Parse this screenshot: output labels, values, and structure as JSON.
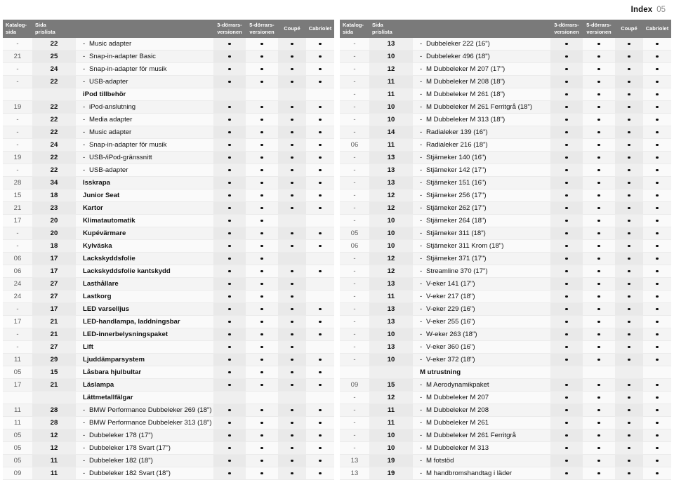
{
  "header": {
    "index_label": "Index",
    "index_number": "05"
  },
  "columns": {
    "katalog_line1": "Katalog-",
    "katalog_line2": "sida",
    "sida_line1": "Sida",
    "sida_line2": "prislista",
    "name": "",
    "d1_line1": "3-dörrars-",
    "d1_line2": "versionen",
    "d2_line1": "5-dörrars-",
    "d2_line2": "versionen",
    "d3": "Coupé",
    "d4": "Cabriolet"
  },
  "left_rows": [
    {
      "kat": "-",
      "sida": "22",
      "dash": "-",
      "name": "Music adapter",
      "bold": false,
      "dots": [
        1,
        1,
        1,
        1
      ]
    },
    {
      "kat": "21",
      "sida": "25",
      "dash": "-",
      "name": "Snap-in-adapter Basic",
      "bold": false,
      "dots": [
        1,
        1,
        1,
        1
      ]
    },
    {
      "kat": "-",
      "sida": "24",
      "dash": "-",
      "name": "Snap-in-adapter för musik",
      "bold": false,
      "dots": [
        1,
        1,
        1,
        1
      ]
    },
    {
      "kat": "-",
      "sida": "22",
      "dash": "-",
      "name": "USB-adapter",
      "bold": false,
      "dots": [
        1,
        1,
        1,
        1
      ]
    },
    {
      "kat": "",
      "sida": "",
      "dash": "",
      "name": "iPod tillbehör",
      "bold": true,
      "group": true,
      "dots": [
        0,
        0,
        0,
        0
      ]
    },
    {
      "kat": "19",
      "sida": "22",
      "dash": "-",
      "name": "iPod-anslutning",
      "bold": false,
      "dots": [
        1,
        1,
        1,
        1
      ]
    },
    {
      "kat": "-",
      "sida": "22",
      "dash": "-",
      "name": "Media adapter",
      "bold": false,
      "dots": [
        1,
        1,
        1,
        1
      ]
    },
    {
      "kat": "-",
      "sida": "22",
      "dash": "-",
      "name": "Music adapter",
      "bold": false,
      "dots": [
        1,
        1,
        1,
        1
      ]
    },
    {
      "kat": "-",
      "sida": "24",
      "dash": "-",
      "name": "Snap-in-adapter för musik",
      "bold": false,
      "dots": [
        1,
        1,
        1,
        1
      ]
    },
    {
      "kat": "19",
      "sida": "22",
      "dash": "-",
      "name": "USB-/iPod-gränssnitt",
      "bold": false,
      "dots": [
        1,
        1,
        1,
        1
      ]
    },
    {
      "kat": "-",
      "sida": "22",
      "dash": "-",
      "name": "USB-adapter",
      "bold": false,
      "dots": [
        1,
        1,
        1,
        1
      ]
    },
    {
      "kat": "28",
      "sida": "34",
      "dash": "",
      "name": "Isskrapa",
      "bold": true,
      "dots": [
        1,
        1,
        1,
        1
      ]
    },
    {
      "kat": "15",
      "sida": "18",
      "dash": "",
      "name": "Junior Seat",
      "bold": true,
      "dots": [
        1,
        1,
        1,
        1
      ]
    },
    {
      "kat": "21",
      "sida": "23",
      "dash": "",
      "name": "Kartor",
      "bold": true,
      "dots": [
        1,
        1,
        1,
        1
      ]
    },
    {
      "kat": "17",
      "sida": "20",
      "dash": "",
      "name": "Klimatautomatik",
      "bold": true,
      "dots": [
        1,
        1,
        0,
        0
      ]
    },
    {
      "kat": "-",
      "sida": "20",
      "dash": "",
      "name": "Kupévärmare",
      "bold": true,
      "dots": [
        1,
        1,
        1,
        1
      ]
    },
    {
      "kat": "-",
      "sida": "18",
      "dash": "",
      "name": "Kylväska",
      "bold": true,
      "dots": [
        1,
        1,
        1,
        1
      ]
    },
    {
      "kat": "06",
      "sida": "17",
      "dash": "",
      "name": "Lackskyddsfolie",
      "bold": true,
      "dots": [
        1,
        1,
        0,
        0
      ]
    },
    {
      "kat": "06",
      "sida": "17",
      "dash": "",
      "name": "Lackskyddsfolie kantskydd",
      "bold": true,
      "dots": [
        1,
        1,
        1,
        1
      ]
    },
    {
      "kat": "24",
      "sida": "27",
      "dash": "",
      "name": "Lasthållare",
      "bold": true,
      "dots": [
        1,
        1,
        1,
        0
      ]
    },
    {
      "kat": "24",
      "sida": "27",
      "dash": "",
      "name": "Lastkorg",
      "bold": true,
      "dots": [
        1,
        1,
        1,
        0
      ]
    },
    {
      "kat": "-",
      "sida": "17",
      "dash": "",
      "name": "LED varselljus",
      "bold": true,
      "dots": [
        1,
        1,
        1,
        1
      ]
    },
    {
      "kat": "17",
      "sida": "21",
      "dash": "",
      "name": "LED-handlampa, laddningsbar",
      "bold": true,
      "dots": [
        1,
        1,
        1,
        1
      ]
    },
    {
      "kat": "-",
      "sida": "21",
      "dash": "",
      "name": "LED-innerbelysningspaket",
      "bold": true,
      "dots": [
        1,
        1,
        1,
        1
      ]
    },
    {
      "kat": "-",
      "sida": "27",
      "dash": "",
      "name": "Lift",
      "bold": true,
      "dots": [
        1,
        1,
        1,
        0
      ]
    },
    {
      "kat": "11",
      "sida": "29",
      "dash": "",
      "name": "Ljuddämparsystem",
      "bold": true,
      "dots": [
        1,
        1,
        1,
        1
      ]
    },
    {
      "kat": "05",
      "sida": "15",
      "dash": "",
      "name": "Låsbara hjulbultar",
      "bold": true,
      "dots": [
        1,
        1,
        1,
        1
      ]
    },
    {
      "kat": "17",
      "sida": "21",
      "dash": "",
      "name": "Läslampa",
      "bold": true,
      "dots": [
        1,
        1,
        1,
        1
      ]
    },
    {
      "kat": "",
      "sida": "",
      "dash": "",
      "name": "Lättmetallfälgar",
      "bold": true,
      "group": true,
      "dots": [
        0,
        0,
        0,
        0
      ]
    },
    {
      "kat": "11",
      "sida": "28",
      "dash": "-",
      "name": "BMW Performance Dubbeleker 269 (18\")",
      "bold": false,
      "dots": [
        1,
        1,
        1,
        1
      ]
    },
    {
      "kat": "11",
      "sida": "28",
      "dash": "-",
      "name": "BMW Performance Dubbeleker 313 (18\")",
      "bold": false,
      "dots": [
        1,
        1,
        1,
        1
      ]
    },
    {
      "kat": "05",
      "sida": "12",
      "dash": "-",
      "name": "Dubbeleker 178 (17\")",
      "bold": false,
      "dots": [
        1,
        1,
        1,
        1
      ]
    },
    {
      "kat": "05",
      "sida": "12",
      "dash": "-",
      "name": "Dubbeleker 178 Svart (17\")",
      "bold": false,
      "dots": [
        1,
        1,
        1,
        1
      ]
    },
    {
      "kat": "05",
      "sida": "11",
      "dash": "-",
      "name": "Dubbeleker 182 (18\")",
      "bold": false,
      "dots": [
        1,
        1,
        1,
        1
      ]
    },
    {
      "kat": "09",
      "sida": "11",
      "dash": "-",
      "name": "Dubbeleker 182 Svart (18\")",
      "bold": false,
      "dots": [
        1,
        1,
        1,
        1
      ]
    }
  ],
  "right_rows": [
    {
      "kat": "-",
      "sida": "13",
      "dash": "-",
      "name": "Dubbeleker 222 (16\")",
      "bold": false,
      "dots": [
        1,
        1,
        1,
        1
      ]
    },
    {
      "kat": "-",
      "sida": "10",
      "dash": "-",
      "name": "Dubbeleker 496 (18\")",
      "bold": false,
      "dots": [
        1,
        1,
        1,
        1
      ]
    },
    {
      "kat": "-",
      "sida": "12",
      "dash": "-",
      "name": "M Dubbeleker M 207 (17\")",
      "bold": false,
      "dots": [
        1,
        1,
        1,
        1
      ]
    },
    {
      "kat": "-",
      "sida": "11",
      "dash": "-",
      "name": "M Dubbeleker M 208 (18\")",
      "bold": false,
      "dots": [
        1,
        1,
        1,
        1
      ]
    },
    {
      "kat": "-",
      "sida": "11",
      "dash": "-",
      "name": "M Dubbeleker M 261 (18\")",
      "bold": false,
      "dots": [
        1,
        1,
        1,
        1
      ]
    },
    {
      "kat": "-",
      "sida": "10",
      "dash": "-",
      "name": "M Dubbeleker M 261 Ferritgrå (18\")",
      "bold": false,
      "dots": [
        1,
        1,
        1,
        1
      ]
    },
    {
      "kat": "-",
      "sida": "10",
      "dash": "-",
      "name": "M Dubbeleker M 313 (18\")",
      "bold": false,
      "dots": [
        1,
        1,
        1,
        1
      ]
    },
    {
      "kat": "-",
      "sida": "14",
      "dash": "-",
      "name": "Radialeker 139 (16\")",
      "bold": false,
      "dots": [
        1,
        1,
        1,
        1
      ]
    },
    {
      "kat": "06",
      "sida": "11",
      "dash": "-",
      "name": "Radialeker 216 (18\")",
      "bold": false,
      "dots": [
        1,
        1,
        1,
        1
      ]
    },
    {
      "kat": "-",
      "sida": "13",
      "dash": "-",
      "name": "Stjärneker 140 (16\")",
      "bold": false,
      "dots": [
        1,
        1,
        1,
        1
      ]
    },
    {
      "kat": "-",
      "sida": "13",
      "dash": "-",
      "name": "Stjärneker 142 (17\")",
      "bold": false,
      "dots": [
        1,
        1,
        1,
        1
      ]
    },
    {
      "kat": "-",
      "sida": "13",
      "dash": "-",
      "name": "Stjärneker 151 (16\")",
      "bold": false,
      "dots": [
        1,
        1,
        1,
        1
      ]
    },
    {
      "kat": "-",
      "sida": "12",
      "dash": "-",
      "name": "Stjärneker 256 (17\")",
      "bold": false,
      "dots": [
        1,
        1,
        1,
        1
      ]
    },
    {
      "kat": "-",
      "sida": "12",
      "dash": "-",
      "name": "Stjärneker 262 (17\")",
      "bold": false,
      "dots": [
        1,
        1,
        1,
        1
      ]
    },
    {
      "kat": "-",
      "sida": "10",
      "dash": "-",
      "name": "Stjärneker 264 (18\")",
      "bold": false,
      "dots": [
        1,
        1,
        1,
        1
      ]
    },
    {
      "kat": "05",
      "sida": "10",
      "dash": "-",
      "name": "Stjärneker 311 (18\")",
      "bold": false,
      "dots": [
        1,
        1,
        1,
        1
      ]
    },
    {
      "kat": "06",
      "sida": "10",
      "dash": "-",
      "name": "Stjärneker 311 Krom (18\")",
      "bold": false,
      "dots": [
        1,
        1,
        1,
        1
      ]
    },
    {
      "kat": "-",
      "sida": "12",
      "dash": "-",
      "name": "Stjärneker 371 (17\")",
      "bold": false,
      "dots": [
        1,
        1,
        1,
        1
      ]
    },
    {
      "kat": "-",
      "sida": "12",
      "dash": "-",
      "name": "Streamline 370 (17\")",
      "bold": false,
      "dots": [
        1,
        1,
        1,
        1
      ]
    },
    {
      "kat": "-",
      "sida": "13",
      "dash": "-",
      "name": "V-eker 141 (17\")",
      "bold": false,
      "dots": [
        1,
        1,
        1,
        1
      ]
    },
    {
      "kat": "-",
      "sida": "11",
      "dash": "-",
      "name": "V-eker 217 (18\")",
      "bold": false,
      "dots": [
        1,
        1,
        1,
        1
      ]
    },
    {
      "kat": "-",
      "sida": "13",
      "dash": "-",
      "name": "V-eker 229 (16\")",
      "bold": false,
      "dots": [
        1,
        1,
        1,
        1
      ]
    },
    {
      "kat": "-",
      "sida": "13",
      "dash": "-",
      "name": "V-eker 255 (16\")",
      "bold": false,
      "dots": [
        1,
        1,
        1,
        1
      ]
    },
    {
      "kat": "-",
      "sida": "10",
      "dash": "-",
      "name": "W-eker 263 (18\")",
      "bold": false,
      "dots": [
        1,
        1,
        1,
        1
      ]
    },
    {
      "kat": "-",
      "sida": "13",
      "dash": "-",
      "name": "V-eker 360 (16\")",
      "bold": false,
      "dots": [
        1,
        1,
        1,
        1
      ]
    },
    {
      "kat": "-",
      "sida": "10",
      "dash": "-",
      "name": "V-eker 372 (18\")",
      "bold": false,
      "dots": [
        1,
        1,
        1,
        1
      ]
    },
    {
      "kat": "",
      "sida": "",
      "dash": "",
      "name": "M utrustning",
      "bold": true,
      "group": true,
      "dots": [
        0,
        0,
        0,
        0
      ]
    },
    {
      "kat": "09",
      "sida": "15",
      "dash": "-",
      "name": "M Aerodynamikpaket",
      "bold": false,
      "dots": [
        1,
        1,
        1,
        1
      ]
    },
    {
      "kat": "-",
      "sida": "12",
      "dash": "-",
      "name": "M Dubbeleker M 207",
      "bold": false,
      "dots": [
        1,
        1,
        1,
        1
      ]
    },
    {
      "kat": "-",
      "sida": "11",
      "dash": "-",
      "name": "M Dubbeleker M 208",
      "bold": false,
      "dots": [
        1,
        1,
        1,
        1
      ]
    },
    {
      "kat": "-",
      "sida": "11",
      "dash": "-",
      "name": "M Dubbeleker M 261",
      "bold": false,
      "dots": [
        1,
        1,
        1,
        1
      ]
    },
    {
      "kat": "-",
      "sida": "10",
      "dash": "-",
      "name": "M Dubbeleker M 261 Ferritgrå",
      "bold": false,
      "dots": [
        1,
        1,
        1,
        1
      ]
    },
    {
      "kat": "-",
      "sida": "10",
      "dash": "-",
      "name": "M Dubbeleker M 313",
      "bold": false,
      "dots": [
        1,
        1,
        1,
        1
      ]
    },
    {
      "kat": "13",
      "sida": "19",
      "dash": "-",
      "name": "M fotstöd",
      "bold": false,
      "dots": [
        1,
        1,
        1,
        1
      ]
    },
    {
      "kat": "13",
      "sida": "19",
      "dash": "-",
      "name": "M handbromshandtag i läder",
      "bold": false,
      "dots": [
        1,
        1,
        1,
        1
      ]
    }
  ],
  "colors": {
    "header_bg": "#7a7a7a",
    "band_light": "#fafafa",
    "band_dark": "#efefef",
    "rule": "#ebebeb",
    "text": "#1a1a1a",
    "muted": "#5e5e5e",
    "index_num": "#8c8c8c"
  }
}
